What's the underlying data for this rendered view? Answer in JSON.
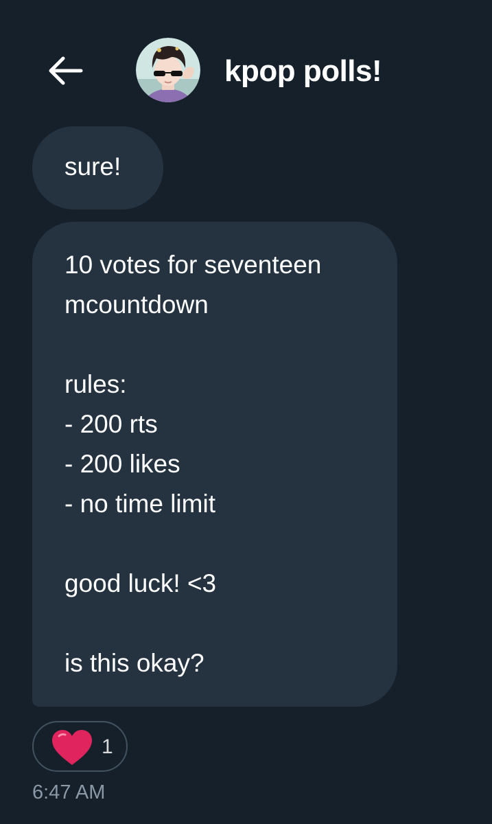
{
  "header": {
    "back_icon": "arrow-left-icon",
    "avatar": "profile-photo",
    "title": "kpop polls!"
  },
  "messages": [
    {
      "lines": [
        "sure!"
      ]
    },
    {
      "lines": [
        "10 votes for seventeen",
        "mcountdown",
        "",
        "rules:",
        "- 200 rts",
        "- 200 likes",
        "- no time limit",
        "",
        "good luck! <3",
        "",
        "is this okay?"
      ]
    }
  ],
  "reaction": {
    "icon": "heart-icon",
    "count": "1"
  },
  "timestamp": "6:47 AM",
  "colors": {
    "background": "#15202b",
    "bubble": "#253341",
    "reaction_border": "#42535f",
    "timestamp": "#8b98a5",
    "heart": "#e0245e"
  }
}
